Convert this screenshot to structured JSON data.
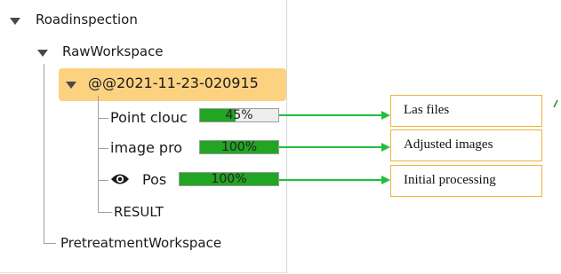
{
  "tree": {
    "root": {
      "label": "Roadinspection"
    },
    "raw_workspace": {
      "label": "RawWorkspace"
    },
    "session": {
      "label": "@@2021-11-23-020915"
    },
    "tasks": [
      {
        "label": "Point clouc",
        "progress_text": "45%",
        "progress": 0.45
      },
      {
        "label": "image pro",
        "progress_text": "100%",
        "progress": 1.0
      },
      {
        "label": "Pos",
        "progress_text": "100%",
        "progress": 1.0,
        "icon": "eye-icon"
      }
    ],
    "result": {
      "label": "RESULT"
    },
    "pretreatment": {
      "label": "PretreatmentWorkspace"
    }
  },
  "callouts": [
    {
      "label": "Las files"
    },
    {
      "label": "Adjusted images"
    },
    {
      "label": "Initial processing"
    }
  ],
  "colors": {
    "progress_fill": "#22a522",
    "selection": "#fcd281",
    "arrow": "#1fbf3f",
    "callout_border": "#f0b43a"
  }
}
